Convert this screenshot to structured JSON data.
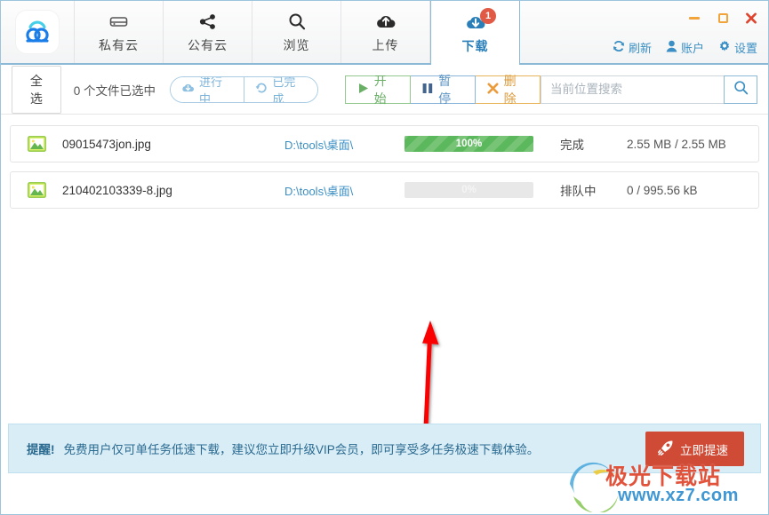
{
  "app": {
    "logo_icon": "cloud-logo-icon"
  },
  "tabs": [
    {
      "id": "private-cloud",
      "label": "私有云",
      "icon": "server-icon",
      "active": false
    },
    {
      "id": "public-cloud",
      "label": "公有云",
      "icon": "share-icon",
      "active": false
    },
    {
      "id": "browse",
      "label": "浏览",
      "icon": "search-icon",
      "active": false
    },
    {
      "id": "upload",
      "label": "上传",
      "icon": "cloud-upload-icon",
      "active": false
    },
    {
      "id": "download",
      "label": "下载",
      "icon": "cloud-download-icon",
      "active": true,
      "badge": "1"
    }
  ],
  "window_controls": {
    "minimize": "minimize-icon",
    "maximize": "maximize-icon",
    "close": "×"
  },
  "top_actions": [
    {
      "id": "refresh",
      "label": "刷新",
      "icon": "refresh-icon"
    },
    {
      "id": "account",
      "label": "账户",
      "icon": "user-icon"
    },
    {
      "id": "settings",
      "label": "设置",
      "icon": "gear-icon"
    }
  ],
  "toolbar": {
    "select_all_label": "全选",
    "selected_count_text": "0 个文件已选中",
    "segments": [
      {
        "id": "in-progress",
        "label": "进行中",
        "icon": "cloud-download-icon"
      },
      {
        "id": "completed",
        "label": "已完成",
        "icon": "history-icon"
      }
    ],
    "operations": [
      {
        "id": "start",
        "label": "开始",
        "icon": "play-icon",
        "color": "#6aaf66"
      },
      {
        "id": "pause",
        "label": "暂停",
        "icon": "pause-icon",
        "color": "#5b94c4"
      },
      {
        "id": "delete",
        "label": "删除",
        "icon": "close-icon",
        "color": "#dd9b3c"
      }
    ],
    "search": {
      "placeholder": "当前位置搜索",
      "value": "",
      "button_icon": "search-icon"
    }
  },
  "files": [
    {
      "icon": "image-file-icon",
      "name": "09015473jon.jpg",
      "path": "D:\\tools\\桌面\\",
      "progress_pct": 100,
      "progress_label": "100%",
      "status": "完成",
      "size": "2.55 MB / 2.55 MB"
    },
    {
      "icon": "image-file-icon",
      "name": "210402103339-8.jpg",
      "path": "D:\\tools\\桌面\\",
      "progress_pct": 0,
      "progress_label": "0%",
      "status": "排队中",
      "size": "0 / 995.56 kB"
    }
  ],
  "annotation": {
    "type": "arrow-up",
    "color": "#fb0606"
  },
  "footer": {
    "tip_label": "提醒!",
    "tip_text": "免费用户仅可单任务低速下载，建议您立即升级VIP会员，即可享受多任务极速下载体验。",
    "boost_button": {
      "label": "立即提速",
      "icon": "rocket-icon"
    }
  },
  "watermark": {
    "line1": "极光下载站",
    "line2": "www.xz7.com",
    "icon": "swoosh-icon"
  },
  "colors": {
    "accent_blue": "#3b8fc4",
    "active_tab_border": "#8cb9d6",
    "badge_red": "#e05a45",
    "progress_green": "#5cb85c",
    "notice_bg": "#d9edf7",
    "boost_red": "#cf4b36",
    "arrow_red": "#fb0606"
  }
}
